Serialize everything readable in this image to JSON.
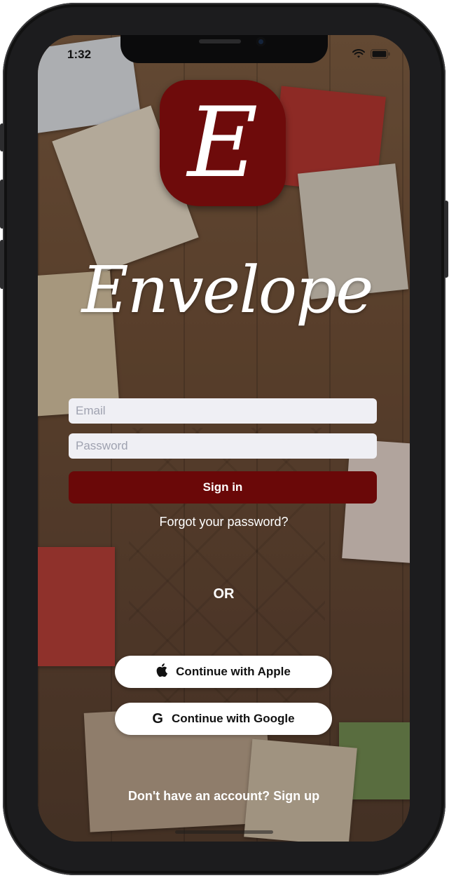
{
  "status_bar": {
    "time": "1:32"
  },
  "brand": {
    "logo_letter": "E",
    "wordmark": "Envelope",
    "color": "#6e0b0b"
  },
  "login_form": {
    "email_placeholder": "Email",
    "password_placeholder": "Password",
    "sign_in_label": "Sign in",
    "forgot_label": "Forgot your password?"
  },
  "divider": {
    "label": "OR"
  },
  "social": {
    "apple_label": "Continue with Apple",
    "apple_icon": "apple-icon",
    "google_label": "Continue with Google",
    "google_icon": "google-icon",
    "google_glyph": "G"
  },
  "footer": {
    "signup_label": "Don't have an account? Sign up"
  }
}
